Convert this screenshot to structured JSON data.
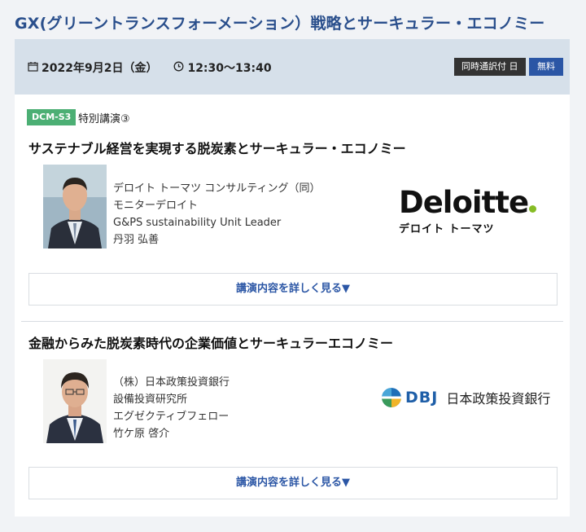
{
  "page": {
    "title": "GX(グリーントランスフォーメーション）戦略とサーキュラー・エコノミー"
  },
  "header": {
    "date_icon": "calendar-icon",
    "date": "2022年9月2日（金）",
    "time_icon": "clock-icon",
    "time": "12:30～13:40",
    "badge_interpretation": "同時通訳付 日",
    "badge_free": "無料"
  },
  "session": {
    "code": "DCM-S3",
    "type": "特別講演③"
  },
  "talks": [
    {
      "title": "サステナブル経営を実現する脱炭素とサーキュラー・エコノミー",
      "speaker_lines": [
        "デロイト トーマツ コンサルティング（同）",
        "モニターデロイト",
        "G&PS sustainability Unit Leader",
        "丹羽 弘善"
      ],
      "logo": {
        "word": "Deloitte",
        "sub": "デロイト トーマツ",
        "dot_color": "#86bc25"
      },
      "detail_label": "講演内容を詳しく見る▼"
    },
    {
      "title": "金融からみた脱炭素時代の企業価値とサーキュラーエコノミー",
      "speaker_lines": [
        "（株）日本政策投資銀行",
        "設備投資研究所",
        "エグゼクティブフェロー",
        "竹ケ原 啓介"
      ],
      "logo": {
        "abbr": "DBJ",
        "name": "日本政策投資銀行"
      },
      "detail_label": "講演内容を詳しく見る▼"
    }
  ],
  "colors": {
    "title_blue": "#2a4f8c",
    "header_bg": "#d6e0ea",
    "code_green": "#4caf74",
    "link_blue": "#2b56a5"
  }
}
